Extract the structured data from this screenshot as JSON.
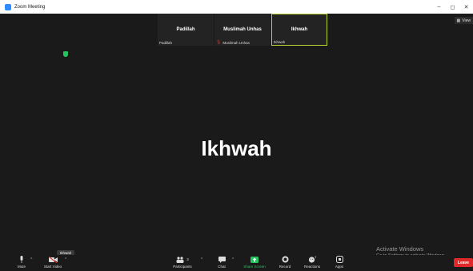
{
  "window": {
    "title": "Zoom Meeting",
    "controls": {
      "minimize": "–",
      "maximize": "◻",
      "close": "✕"
    }
  },
  "view": {
    "label": "View"
  },
  "participants_strip": [
    {
      "display_name": "Padillah",
      "label": "Padillah",
      "muted": false,
      "active": false
    },
    {
      "display_name": "Muslimah Unhas",
      "label": "Muslimah Unhas",
      "muted": true,
      "active": false
    },
    {
      "display_name": "Ikhwah",
      "label": "Ikhwah",
      "muted": false,
      "active": true
    }
  ],
  "main_speaker": {
    "name": "Ikhwah"
  },
  "tooltip": {
    "text": "Ikhwah"
  },
  "toolbar": {
    "mute": "Mute",
    "start_video": "Start Video",
    "participants": "Participants",
    "participants_count": "3",
    "chat": "Chat",
    "share_screen": "Share Screen",
    "record": "Record",
    "reactions": "Reactions",
    "apps": "Apps",
    "leave": "Leave"
  },
  "watermark": {
    "title": "Activate Windows",
    "subtitle": "Go to Settings to activate Windows."
  },
  "colors": {
    "accent_green": "#24c461",
    "leave_red": "#e02828",
    "active_border": "#b8d334",
    "brand_blue": "#2d8cff"
  }
}
